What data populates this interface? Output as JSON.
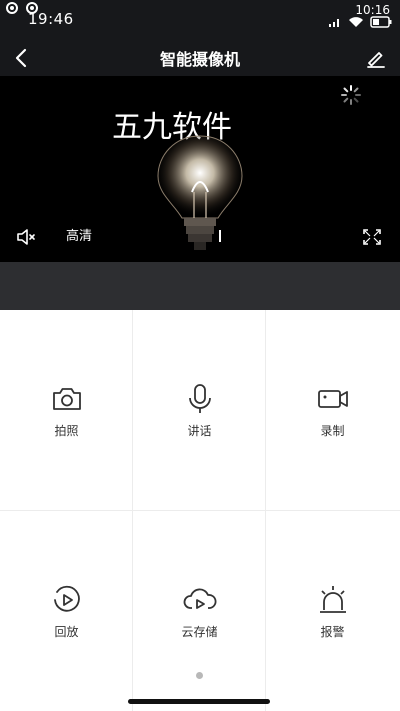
{
  "status_bar": {
    "time_left": "19:46",
    "time_right": "10:16",
    "icons": [
      "signal-icon",
      "wifi-icon",
      "battery-icon"
    ]
  },
  "nav": {
    "title": "智能摄像机",
    "back_icon": "back-arrow-icon",
    "edit_icon": "edit-pencil-icon"
  },
  "video": {
    "watermark": "五九软件",
    "quality": "高清",
    "icons": [
      "mute-icon",
      "fullscreen-icon",
      "loading-spinner-icon"
    ]
  },
  "actions": [
    {
      "label": "拍照",
      "icon": "camera-icon"
    },
    {
      "label": "讲话",
      "icon": "microphone-icon"
    },
    {
      "label": "录制",
      "icon": "video-record-icon"
    },
    {
      "label": "回放",
      "icon": "playback-icon"
    },
    {
      "label": "云存储",
      "icon": "cloud-storage-icon"
    },
    {
      "label": "报警",
      "icon": "alarm-icon"
    }
  ],
  "colors": {
    "topbar": "#17181b",
    "gapbar": "#2d2e31",
    "accent_icon": "#333333"
  }
}
